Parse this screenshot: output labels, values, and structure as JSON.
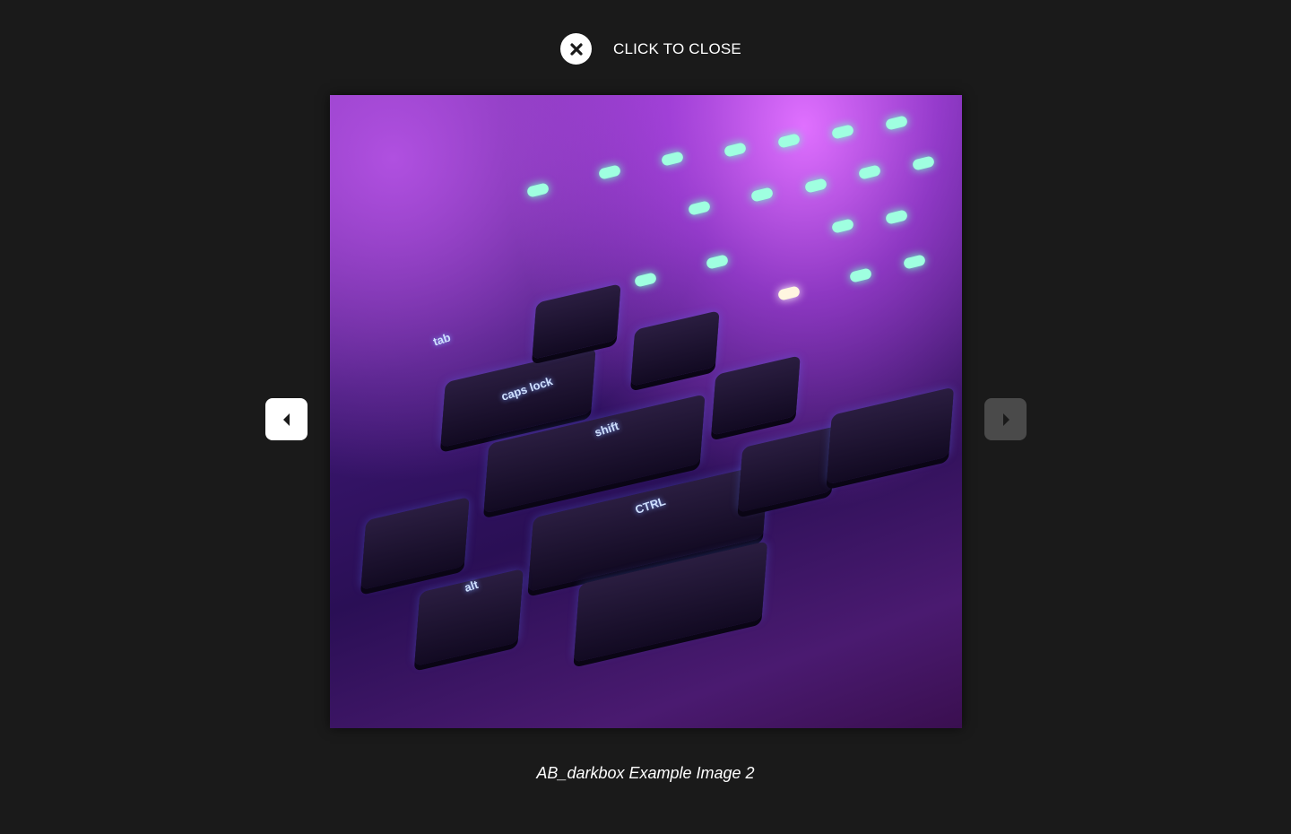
{
  "lightbox": {
    "close_label": "CLICK TO CLOSE",
    "close_icon": "close-icon",
    "prev_icon": "triangle-left-icon",
    "next_icon": "triangle-right-icon",
    "caption": "AB_darkbox Example Image 2",
    "image_alt": "Backlit mechanical keyboard under purple light",
    "key_legends": [
      "shift",
      "CTRL",
      "caps lock",
      "tab",
      "alt"
    ],
    "colors": {
      "background": "#1a1a1a",
      "prev_button": "#ffffff",
      "next_button": "#4a4a4a"
    }
  }
}
